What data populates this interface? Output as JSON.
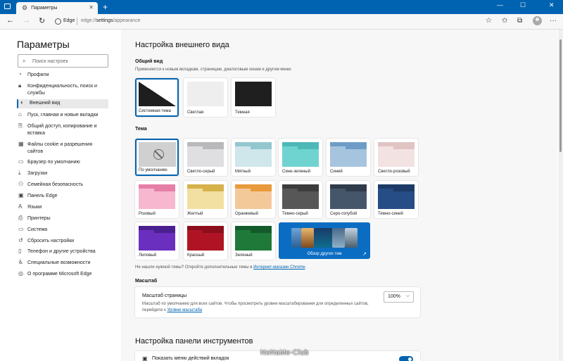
{
  "titlebar": {
    "tab_title": "Параметры",
    "tab_close": "✕",
    "new_tab": "+",
    "minimize": "—",
    "maximize": "☐",
    "close": "✕"
  },
  "addressbar": {
    "back": "←",
    "forward": "→",
    "refresh": "↻",
    "site_label": "Edge",
    "url_prefix": "edge://",
    "url_path": "settings",
    "url_rest": "/appearance",
    "icons": [
      "star-add-icon",
      "favorites-icon",
      "collections-icon",
      "profile-avatar",
      "more-icon"
    ],
    "more": "···"
  },
  "sidebar": {
    "title": "Параметры",
    "search_placeholder": "Поиск настроек",
    "items": [
      {
        "label": "Профили",
        "icon": "profile-icon"
      },
      {
        "label": "Конфиденциальность, поиск и службы",
        "icon": "lock-icon"
      },
      {
        "label": "Внешний вид",
        "icon": "appearance-icon"
      },
      {
        "label": "Пуск, главная и новые вкладки",
        "icon": "home-icon"
      },
      {
        "label": "Общий доступ, копирование и вставка",
        "icon": "share-icon"
      },
      {
        "label": "Файлы cookie и разрешения сайтов",
        "icon": "cookie-icon"
      },
      {
        "label": "Браузер по умолчанию",
        "icon": "browser-icon"
      },
      {
        "label": "Загрузки",
        "icon": "download-icon"
      },
      {
        "label": "Семейная безопасность",
        "icon": "family-icon"
      },
      {
        "label": "Панель Edge",
        "icon": "sidebar-panel-icon"
      },
      {
        "label": "Языки",
        "icon": "language-icon"
      },
      {
        "label": "Принтеры",
        "icon": "printer-icon"
      },
      {
        "label": "Система",
        "icon": "system-icon"
      },
      {
        "label": "Сбросить настройки",
        "icon": "reset-icon"
      },
      {
        "label": "Телефон и другие устройства",
        "icon": "phone-icon"
      },
      {
        "label": "Специальные возможности",
        "icon": "accessibility-icon"
      },
      {
        "label": "О программе Microsoft Edge",
        "icon": "edge-icon"
      }
    ]
  },
  "main": {
    "title": "Настройка внешнего вида",
    "general": {
      "heading": "Общий вид",
      "description": "Применяется к новым вкладкам, страницам, диалоговым окнам и другим меню",
      "options": [
        {
          "label": "Системная тема",
          "selected": true
        },
        {
          "label": "Светлая",
          "selected": false
        },
        {
          "label": "Темная",
          "selected": false
        }
      ]
    },
    "theme": {
      "heading": "Тема",
      "options": [
        {
          "label": "По умолчанию",
          "selected": true,
          "colors": [
            "#d0d0d0",
            "#d0d0d0"
          ]
        },
        {
          "label": "Светло-серый",
          "colors": [
            "#b9b9bb",
            "#dfdfe1"
          ]
        },
        {
          "label": "Мятный",
          "colors": [
            "#92c7cf",
            "#cfe6ea"
          ]
        },
        {
          "label": "Сине-зеленый",
          "colors": [
            "#4cb8b8",
            "#6fd3d0"
          ]
        },
        {
          "label": "Синий",
          "colors": [
            "#6d9dc6",
            "#a6c4de"
          ]
        },
        {
          "label": "Светло-розовый",
          "colors": [
            "#e0c3c3",
            "#f3e2e2"
          ]
        },
        {
          "label": "Розовый",
          "colors": [
            "#e67fa6",
            "#f7b7cf"
          ]
        },
        {
          "label": "Желтый",
          "colors": [
            "#d6b24a",
            "#f2e0a2"
          ]
        },
        {
          "label": "Оранжевый",
          "colors": [
            "#e89a3c",
            "#f4c99a"
          ]
        },
        {
          "label": "Темно-серый",
          "colors": [
            "#3c3c3c",
            "#575757"
          ]
        },
        {
          "label": "Серо-голубой",
          "colors": [
            "#2f3b4a",
            "#46566a"
          ]
        },
        {
          "label": "Темно-синий",
          "colors": [
            "#1c3a66",
            "#264d85"
          ]
        },
        {
          "label": "Лиловый",
          "colors": [
            "#4a1f8f",
            "#6b2fbf"
          ]
        },
        {
          "label": "Красный",
          "colors": [
            "#8c0d1c",
            "#b01424"
          ]
        },
        {
          "label": "Зеленый",
          "colors": [
            "#135a2a",
            "#1f7a3a"
          ]
        }
      ],
      "explore_label": "Обзор других тем",
      "explore_icon": "external-link-icon"
    },
    "note_text": "Не нашли нужной темы? Откройте дополнительные темы в ",
    "note_link": "Интернет-магазин Chrome",
    "note_end": ".",
    "zoom": {
      "heading": "Масштаб",
      "title": "Масштаб страницы",
      "description": "Масштаб по умолчанию для всех сайтов. Чтобы просмотреть уровни масштабирования для определенных сайтов, перейдите к ",
      "link": "Уровни масштаба",
      "value": "100%"
    },
    "toolbar": {
      "title": "Настройка панели инструментов",
      "item_label": "Показать меню действий вкладок",
      "toggle_on": true
    },
    "watermark": "NoNaMe-Club",
    "colors": {
      "accent": "#0063b1",
      "titlebar": "#0063b1"
    }
  }
}
